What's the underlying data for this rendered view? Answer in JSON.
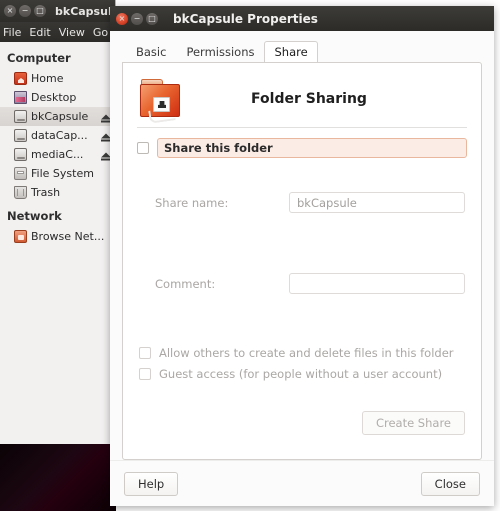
{
  "file_manager": {
    "title": "bkCapsule",
    "window_buttons": [
      "close",
      "minimize",
      "maximize"
    ],
    "menu": [
      "File",
      "Edit",
      "View",
      "Go"
    ],
    "sidebar": {
      "sections": [
        {
          "heading": "Computer",
          "items": [
            {
              "label": "Home",
              "icon": "home-icon",
              "eject": false,
              "selected": false
            },
            {
              "label": "Desktop",
              "icon": "desktop-icon",
              "eject": false,
              "selected": false
            },
            {
              "label": "bkCapsule",
              "icon": "drive-icon",
              "eject": true,
              "selected": true
            },
            {
              "label": "dataCap...",
              "icon": "drive-icon",
              "eject": true,
              "selected": false
            },
            {
              "label": "mediaC...",
              "icon": "drive-icon",
              "eject": true,
              "selected": false
            },
            {
              "label": "File System",
              "icon": "filesystem-icon",
              "eject": false,
              "selected": false
            },
            {
              "label": "Trash",
              "icon": "trash-icon",
              "eject": false,
              "selected": false
            }
          ]
        },
        {
          "heading": "Network",
          "items": [
            {
              "label": "Browse Net...",
              "icon": "network-icon",
              "eject": false,
              "selected": false
            }
          ]
        }
      ]
    }
  },
  "dialog": {
    "title": "bkCapsule Properties",
    "tabs": [
      {
        "label": "Basic",
        "active": false
      },
      {
        "label": "Permissions",
        "active": false
      },
      {
        "label": "Share",
        "active": true
      }
    ],
    "share_panel": {
      "heading": "Folder Sharing",
      "folder_icon": "shared-folder-icon",
      "share_this_folder": {
        "label": "Share this folder",
        "checked": false,
        "highlight_bg": "#fcece6",
        "highlight_border": "#e8b79d"
      },
      "fields": [
        {
          "label": "Share name:",
          "value": "bkCapsule",
          "placeholder": "",
          "disabled": true
        },
        {
          "label": "Comment:",
          "value": "",
          "placeholder": "",
          "disabled": true
        }
      ],
      "options": [
        {
          "label": "Allow others to create and delete files in this folder",
          "checked": false,
          "disabled": true
        },
        {
          "label": "Guest access (for people without a user account)",
          "checked": false,
          "disabled": true
        }
      ],
      "create_share_button": {
        "label": "Create Share",
        "disabled": true
      }
    },
    "footer": {
      "help_label": "Help",
      "close_label": "Close"
    }
  }
}
